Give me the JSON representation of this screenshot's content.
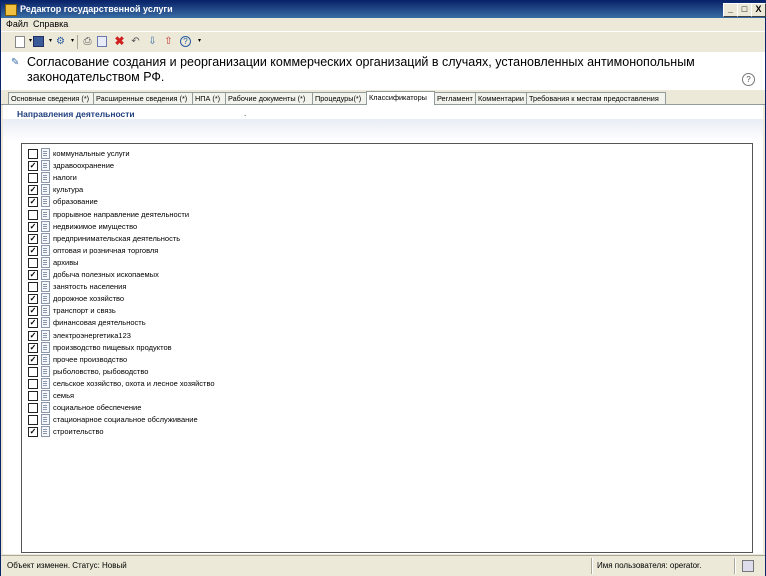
{
  "window": {
    "title": "Редактор государственной услуги",
    "controls": {
      "minimize": "_",
      "maximize": "□",
      "close": "X"
    }
  },
  "menu": [
    "Файл",
    "Справка"
  ],
  "toolbar": {
    "icons": [
      "new-document-icon",
      "save-icon",
      "settings-icon",
      "print-icon",
      "copy-icon",
      "delete-icon",
      "undo-icon",
      "export-icon",
      "import-icon",
      "help-icon"
    ]
  },
  "header": {
    "title": "Согласование создания и реорганизации коммерческих организаций в случаях, установленных антимонопольным законодательством РФ.",
    "help": "?"
  },
  "tabs": [
    {
      "label": "Основные сведения (*)",
      "active": false
    },
    {
      "label": "Расширенные сведения (*)",
      "active": false
    },
    {
      "label": "НПА (*)",
      "active": false
    },
    {
      "label": "Рабочие документы (*)",
      "active": false
    },
    {
      "label": "Процедуры(*)",
      "active": false
    },
    {
      "label": "Классификаторы",
      "active": true
    },
    {
      "label": "Регламент",
      "active": false
    },
    {
      "label": "Комментарии",
      "active": false
    },
    {
      "label": "Требования к местам предоставления",
      "active": false
    }
  ],
  "section": {
    "title": "Направления деятельности",
    "dot": "."
  },
  "items": [
    {
      "label": "коммунальные услуги",
      "checked": false
    },
    {
      "label": "здравоохранение",
      "checked": true
    },
    {
      "label": "налоги",
      "checked": false
    },
    {
      "label": "культура",
      "checked": true
    },
    {
      "label": "образование",
      "checked": true
    },
    {
      "label": "прорывное направление деятельности",
      "checked": false
    },
    {
      "label": "недвижимое имущество",
      "checked": true
    },
    {
      "label": "предпринимательская деятельность",
      "checked": true
    },
    {
      "label": "оптовая и розничная торговля",
      "checked": true
    },
    {
      "label": "архивы",
      "checked": false
    },
    {
      "label": "добыча полезных ископаемых",
      "checked": true
    },
    {
      "label": "занятость населения",
      "checked": false
    },
    {
      "label": "дорожное хозяйство",
      "checked": true
    },
    {
      "label": "транспорт и связь",
      "checked": true
    },
    {
      "label": "финансовая деятельность",
      "checked": true
    },
    {
      "label": "электроэнергетика123",
      "checked": true
    },
    {
      "label": "производство пищевых продуктов",
      "checked": true
    },
    {
      "label": "прочее производство",
      "checked": true
    },
    {
      "label": "рыболовство, рыбоводство",
      "checked": false
    },
    {
      "label": "сельское хозяйство, охота и лесное хозяйство",
      "checked": false
    },
    {
      "label": "семья",
      "checked": false
    },
    {
      "label": "социальное обеспечение",
      "checked": false
    },
    {
      "label": "стационарное социальное обслуживание",
      "checked": false
    },
    {
      "label": "строительство",
      "checked": true
    }
  ],
  "status": {
    "left": "Объект изменен. Статус: Новый",
    "user": "Имя пользователя: operator."
  }
}
